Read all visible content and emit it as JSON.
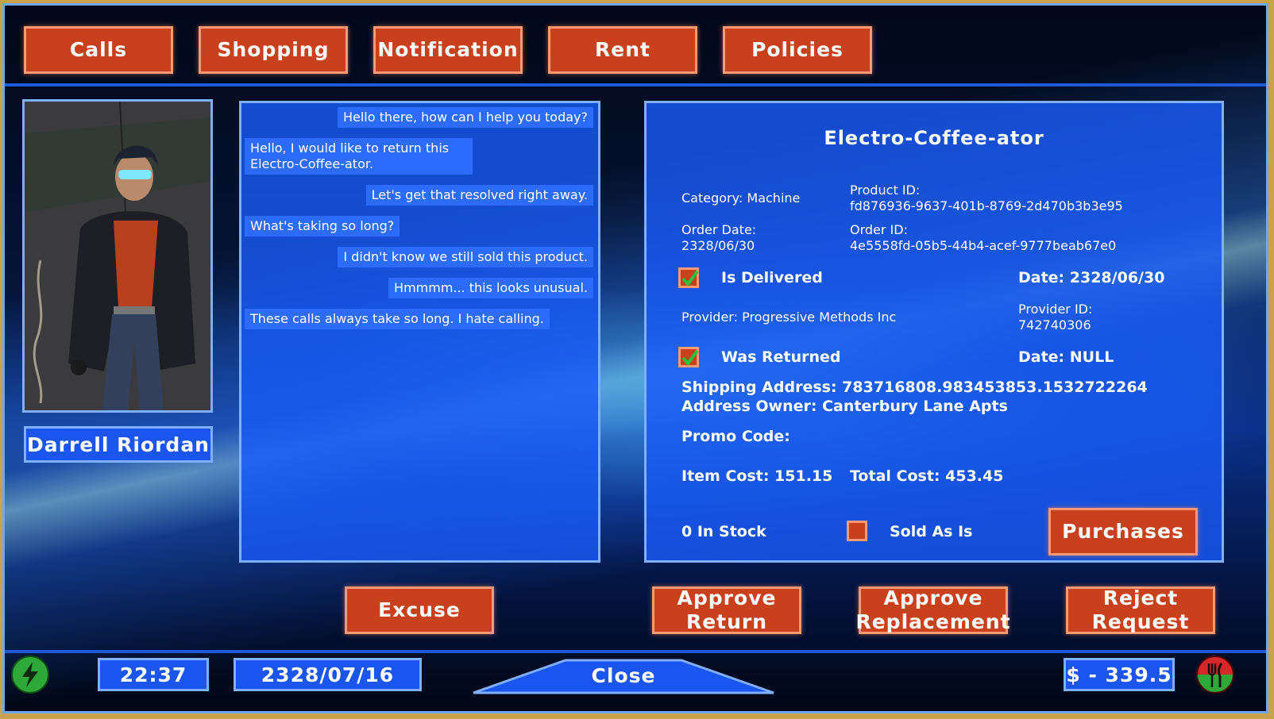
{
  "top_nav": [
    "Calls",
    "Shopping",
    "Notification",
    "Rent",
    "Policies"
  ],
  "caller": {
    "name": "Darrell Riordan"
  },
  "chat": [
    {
      "text": "Hello there, how can I help you today?",
      "side": "right"
    },
    {
      "text": "Hello, I would like to return this\nElectro-Coffee-ator.",
      "side": "left"
    },
    {
      "text": "Let's get that resolved right away.",
      "side": "right"
    },
    {
      "text": "What's taking so long?",
      "side": "left"
    },
    {
      "text": "I didn't know we still sold this product.",
      "side": "right"
    },
    {
      "text": "Hmmmm... this looks unusual.",
      "side": "right"
    },
    {
      "text": "These calls always take so long. I hate calling.",
      "side": "left"
    }
  ],
  "product": {
    "title": "Electro-Coffee-ator",
    "category": "Category: Machine",
    "product_id": "Product ID:\nfd876936-9637-401b-8769-2d470b3b3e95",
    "order_date": "Order Date:\n2328/06/30",
    "order_id": "Order ID:\n4e5558fd-05b5-44b4-acef-9777beab67e0",
    "delivered_label": "Is Delivered",
    "delivered_checked": true,
    "delivered_date": "Date: 2328/06/30",
    "provider": "Provider: Progressive Methods Inc",
    "provider_id": "Provider ID:\n742740306",
    "returned_label": "Was Returned",
    "returned_checked": true,
    "returned_date": "Date: NULL",
    "shipping_address": "Shipping Address: 783716808.983453853.1532722264",
    "address_owner": "Address Owner: Canterbury Lane Apts",
    "promo_code": "Promo Code:",
    "item_cost": "Item Cost: 151.15",
    "total_cost": "Total Cost: 453.45",
    "stock": "0 In Stock",
    "sold_as_is_label": "Sold As Is",
    "sold_as_is_checked": false,
    "purchases_label": "Purchases"
  },
  "actions": {
    "excuse": "Excuse",
    "approve_return": "Approve\nReturn",
    "approve_replacement": "Approve\nReplacement",
    "reject_request": "Reject\nRequest"
  },
  "status_bar": {
    "time": "22:37",
    "date": "2328/07/16",
    "close": "Close",
    "money": "$ - 339.5"
  },
  "colors": {
    "button": "#c8401c",
    "button_border": "#ff9a74",
    "panel": "#1f5cf5",
    "panel_border": "#7fb0ff",
    "check": "#2fbf3a"
  },
  "icons": [
    "lightning-icon",
    "food-icon",
    "check-icon"
  ]
}
